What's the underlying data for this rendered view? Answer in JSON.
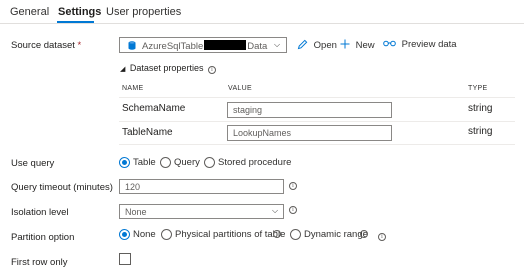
{
  "tabs": [
    {
      "label": "General"
    },
    {
      "label": "Settings"
    },
    {
      "label": "User properties"
    }
  ],
  "source_dataset": {
    "label": "Source dataset",
    "required_mark": "*",
    "value_prefix": "AzureSqlTable",
    "value_suffix": "Data",
    "open_label": "Open",
    "new_label": "New",
    "preview_label": "Preview data"
  },
  "dataset_properties": {
    "toggle_glyph": "◢",
    "title": "Dataset properties",
    "columns": {
      "name": "NAME",
      "value": "VALUE",
      "type": "TYPE"
    },
    "rows": [
      {
        "name": "SchemaName",
        "value": "staging",
        "type": "string"
      },
      {
        "name": "TableName",
        "value": "LookupNames",
        "type": "string"
      }
    ]
  },
  "use_query": {
    "label": "Use query",
    "options": [
      "Table",
      "Query",
      "Stored procedure"
    ],
    "selected": "Table"
  },
  "query_timeout": {
    "label": "Query timeout (minutes)",
    "value": "120"
  },
  "isolation_level": {
    "label": "Isolation level",
    "value": "None"
  },
  "partition_option": {
    "label": "Partition option",
    "options": [
      "None",
      "Physical partitions of table",
      "Dynamic range"
    ],
    "selected": "None"
  },
  "first_row_only": {
    "label": "First row only",
    "checked": false
  },
  "colors": {
    "accent": "#0078d4",
    "required": "#a4262c",
    "border": "#8a8886"
  },
  "icons": {
    "info": "i",
    "chevron": "⌵"
  }
}
